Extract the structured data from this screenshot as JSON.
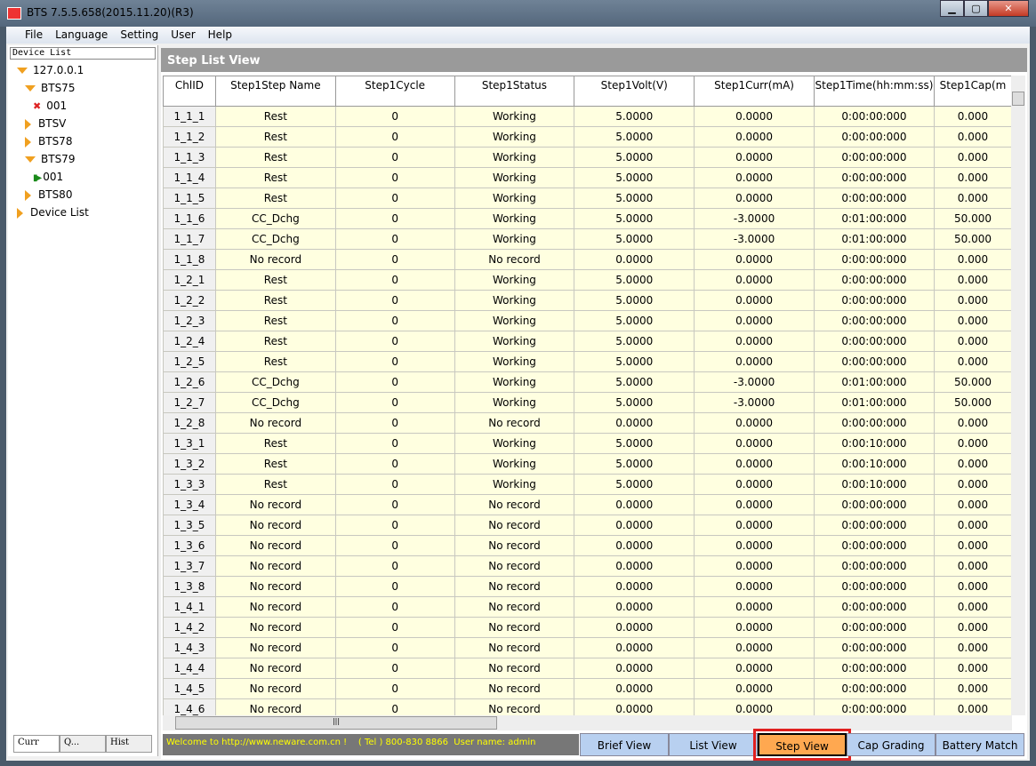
{
  "window": {
    "title": "BTS 7.5.5.658(2015.11.20)(R3)"
  },
  "menu": [
    "File",
    "Language",
    "Setting",
    "User",
    "Help"
  ],
  "sidebar": {
    "header": "Device List",
    "tree": [
      {
        "label": "127.0.0.1",
        "indent": 0,
        "icon": "expanded-triangle"
      },
      {
        "label": "BTS75",
        "indent": 1,
        "icon": "expanded-triangle"
      },
      {
        "label": "001",
        "indent": 2,
        "icon": "disconnected-device-icon"
      },
      {
        "label": "BTSV",
        "indent": 1,
        "icon": "collapsed-triangle"
      },
      {
        "label": "BTS78",
        "indent": 1,
        "icon": "collapsed-triangle"
      },
      {
        "label": "BTS79",
        "indent": 1,
        "icon": "expanded-triangle"
      },
      {
        "label": "001",
        "indent": 2,
        "icon": "running-device-icon"
      },
      {
        "label": "BTS80",
        "indent": 1,
        "icon": "collapsed-triangle"
      },
      {
        "label": "Device List",
        "indent": 0,
        "icon": "collapsed-triangle"
      }
    ],
    "tabs": [
      "Curr",
      "Q...",
      "Hist"
    ]
  },
  "view": {
    "title": "Step List View",
    "columns": [
      "ChlID",
      "Step1Step Name",
      "Step1Cycle",
      "Step1Status",
      "Step1Volt(V)",
      "Step1Curr(mA)",
      "Step1Time(hh:mm:ss)",
      "Step1Cap(m"
    ],
    "rows": [
      [
        "1_1_1",
        "Rest",
        "0",
        "Working",
        "5.0000",
        "0.0000",
        "0:00:00:000",
        "0.000"
      ],
      [
        "1_1_2",
        "Rest",
        "0",
        "Working",
        "5.0000",
        "0.0000",
        "0:00:00:000",
        "0.000"
      ],
      [
        "1_1_3",
        "Rest",
        "0",
        "Working",
        "5.0000",
        "0.0000",
        "0:00:00:000",
        "0.000"
      ],
      [
        "1_1_4",
        "Rest",
        "0",
        "Working",
        "5.0000",
        "0.0000",
        "0:00:00:000",
        "0.000"
      ],
      [
        "1_1_5",
        "Rest",
        "0",
        "Working",
        "5.0000",
        "0.0000",
        "0:00:00:000",
        "0.000"
      ],
      [
        "1_1_6",
        "CC_Dchg",
        "0",
        "Working",
        "5.0000",
        "-3.0000",
        "0:01:00:000",
        "50.000"
      ],
      [
        "1_1_7",
        "CC_Dchg",
        "0",
        "Working",
        "5.0000",
        "-3.0000",
        "0:01:00:000",
        "50.000"
      ],
      [
        "1_1_8",
        "No record",
        "0",
        "No record",
        "0.0000",
        "0.0000",
        "0:00:00:000",
        "0.000"
      ],
      [
        "1_2_1",
        "Rest",
        "0",
        "Working",
        "5.0000",
        "0.0000",
        "0:00:00:000",
        "0.000"
      ],
      [
        "1_2_2",
        "Rest",
        "0",
        "Working",
        "5.0000",
        "0.0000",
        "0:00:00:000",
        "0.000"
      ],
      [
        "1_2_3",
        "Rest",
        "0",
        "Working",
        "5.0000",
        "0.0000",
        "0:00:00:000",
        "0.000"
      ],
      [
        "1_2_4",
        "Rest",
        "0",
        "Working",
        "5.0000",
        "0.0000",
        "0:00:00:000",
        "0.000"
      ],
      [
        "1_2_5",
        "Rest",
        "0",
        "Working",
        "5.0000",
        "0.0000",
        "0:00:00:000",
        "0.000"
      ],
      [
        "1_2_6",
        "CC_Dchg",
        "0",
        "Working",
        "5.0000",
        "-3.0000",
        "0:01:00:000",
        "50.000"
      ],
      [
        "1_2_7",
        "CC_Dchg",
        "0",
        "Working",
        "5.0000",
        "-3.0000",
        "0:01:00:000",
        "50.000"
      ],
      [
        "1_2_8",
        "No record",
        "0",
        "No record",
        "0.0000",
        "0.0000",
        "0:00:00:000",
        "0.000"
      ],
      [
        "1_3_1",
        "Rest",
        "0",
        "Working",
        "5.0000",
        "0.0000",
        "0:00:10:000",
        "0.000"
      ],
      [
        "1_3_2",
        "Rest",
        "0",
        "Working",
        "5.0000",
        "0.0000",
        "0:00:10:000",
        "0.000"
      ],
      [
        "1_3_3",
        "Rest",
        "0",
        "Working",
        "5.0000",
        "0.0000",
        "0:00:10:000",
        "0.000"
      ],
      [
        "1_3_4",
        "No record",
        "0",
        "No record",
        "0.0000",
        "0.0000",
        "0:00:00:000",
        "0.000"
      ],
      [
        "1_3_5",
        "No record",
        "0",
        "No record",
        "0.0000",
        "0.0000",
        "0:00:00:000",
        "0.000"
      ],
      [
        "1_3_6",
        "No record",
        "0",
        "No record",
        "0.0000",
        "0.0000",
        "0:00:00:000",
        "0.000"
      ],
      [
        "1_3_7",
        "No record",
        "0",
        "No record",
        "0.0000",
        "0.0000",
        "0:00:00:000",
        "0.000"
      ],
      [
        "1_3_8",
        "No record",
        "0",
        "No record",
        "0.0000",
        "0.0000",
        "0:00:00:000",
        "0.000"
      ],
      [
        "1_4_1",
        "No record",
        "0",
        "No record",
        "0.0000",
        "0.0000",
        "0:00:00:000",
        "0.000"
      ],
      [
        "1_4_2",
        "No record",
        "0",
        "No record",
        "0.0000",
        "0.0000",
        "0:00:00:000",
        "0.000"
      ],
      [
        "1_4_3",
        "No record",
        "0",
        "No record",
        "0.0000",
        "0.0000",
        "0:00:00:000",
        "0.000"
      ],
      [
        "1_4_4",
        "No record",
        "0",
        "No record",
        "0.0000",
        "0.0000",
        "0:00:00:000",
        "0.000"
      ],
      [
        "1_4_5",
        "No record",
        "0",
        "No record",
        "0.0000",
        "0.0000",
        "0:00:00:000",
        "0.000"
      ],
      [
        "1_4_6",
        "No record",
        "0",
        "No record",
        "0.0000",
        "0.0000",
        "0:00:00:000",
        "0.000"
      ]
    ]
  },
  "status": {
    "text": "Welcome to http://www.neware.com.cn !    ( Tel ) 800-830 8866  User name: admin"
  },
  "view_tabs": [
    "Brief View",
    "List View",
    "Step View",
    "Cap Grading",
    "Battery Match"
  ],
  "active_view_tab": "Step View",
  "colors": {
    "active_tab": "#ffa850",
    "tab": "#b8d0f0",
    "highlight": "#e02020",
    "cell": "#ffffe0"
  }
}
